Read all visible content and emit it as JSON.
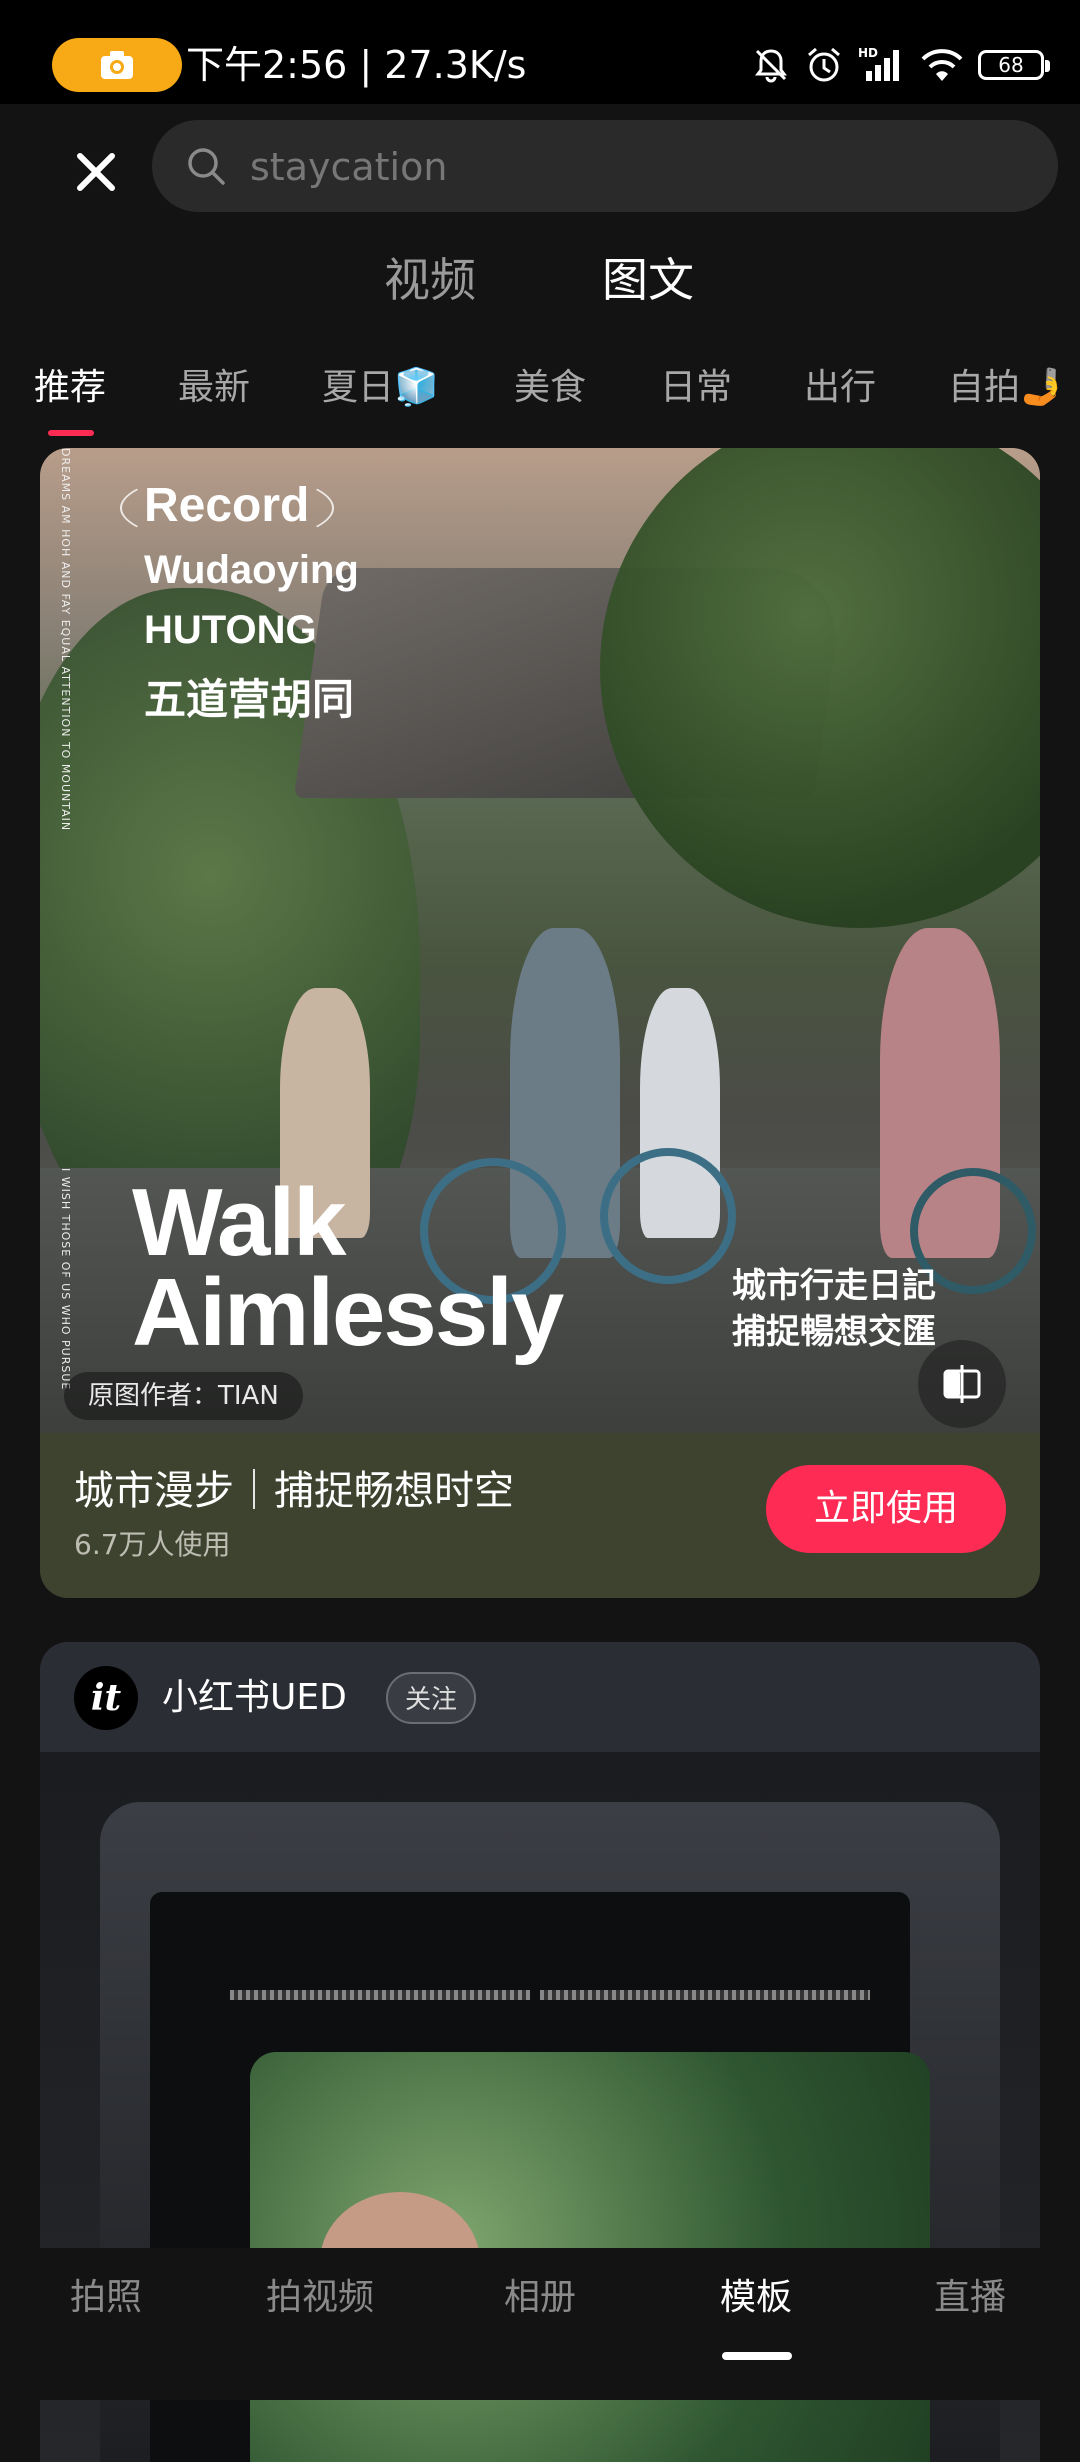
{
  "status": {
    "time_speed": "下午2:56 | 27.3K/s",
    "battery": "68",
    "icons": [
      "camera-record-icon",
      "mute-bell-icon",
      "alarm-icon",
      "hd-signal-icon",
      "wifi-icon",
      "battery-icon"
    ]
  },
  "search": {
    "placeholder": "staycation",
    "close_icon": "close-icon",
    "search_icon": "search-icon"
  },
  "media_tabs": {
    "video": "视频",
    "photo": "图文",
    "active": "图文"
  },
  "category_tabs": [
    {
      "label": "推荐",
      "active": true
    },
    {
      "label": "最新"
    },
    {
      "label": "夏日🧊"
    },
    {
      "label": "美食"
    },
    {
      "label": "日常"
    },
    {
      "label": "出行"
    },
    {
      "label": "自拍🤳"
    }
  ],
  "template_card": {
    "overlay": {
      "record": "Record",
      "line1": "Wudaoying",
      "line2": "HUTONG",
      "line3": "五道营胡同",
      "side_text_top": "DREAMS AM HOH AND FAY EQUAL ATTENTION TO MOUNTAIN",
      "side_text_bottom": "I WISH THOSE OF US WHO PURSUE",
      "walk1": "Walk",
      "walk2": "Aimlessly",
      "cn_a": "城市行走日記",
      "cn_b": "捕捉暢想交匯"
    },
    "author": "原图作者：TIAN",
    "title": "城市漫步｜捕捉畅想时空",
    "usage": "6.7万人使用",
    "use_button": "立即使用",
    "footer_color": "#3e4330"
  },
  "post_card": {
    "avatar_text": "it",
    "user_name": "小红书UED",
    "follow_button": "关注"
  },
  "bottom_nav": [
    {
      "label": "拍照"
    },
    {
      "label": "拍视频"
    },
    {
      "label": "相册"
    },
    {
      "label": "模板",
      "active": true
    },
    {
      "label": "直播"
    }
  ],
  "colors": {
    "accent": "#fe2c55",
    "recording": "#f7a916",
    "background": "#131313"
  }
}
